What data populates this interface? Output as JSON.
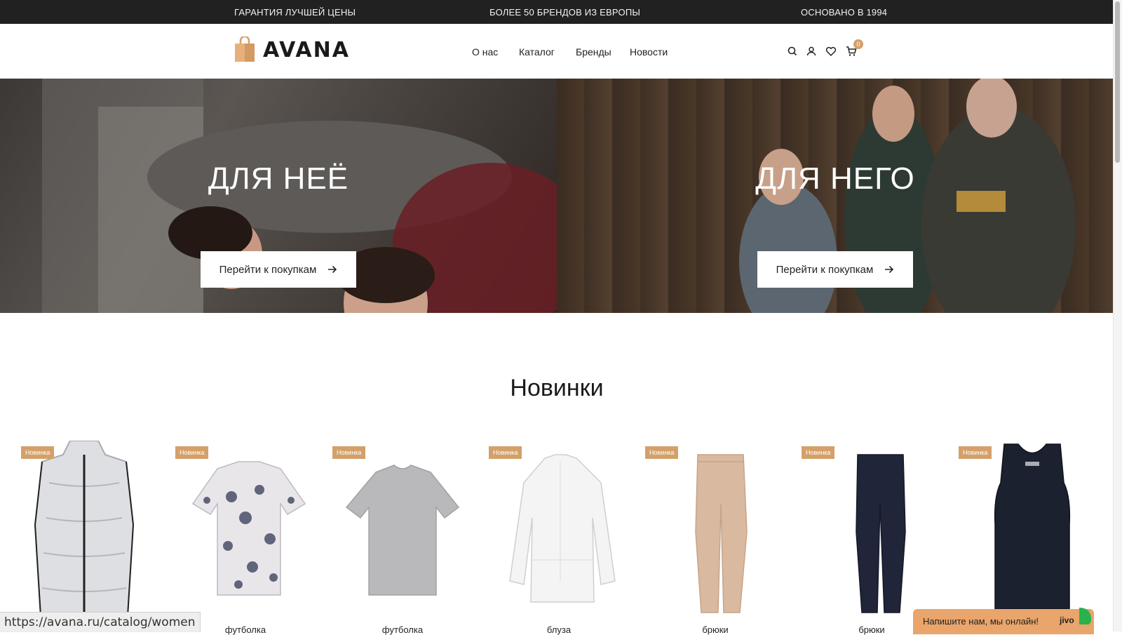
{
  "topbar": {
    "left": "ГАРАНТИЯ ЛУЧШЕЙ ЦЕНЫ",
    "center": "БОЛЕЕ 50 БРЕНДОВ ИЗ ЕВРОПЫ",
    "right": "ОСНОВАНО В 1994"
  },
  "header": {
    "logo_text": "AVANA",
    "nav": [
      "О нас",
      "Каталог",
      "Бренды",
      "Новости"
    ],
    "icons": [
      "search-icon",
      "user-icon",
      "heart-icon",
      "cart-icon"
    ],
    "cart_count": "0"
  },
  "hero": {
    "left": {
      "title": "ДЛЯ НЕЁ",
      "button": "Перейти к покупкам"
    },
    "right": {
      "title": "ДЛЯ НЕГО",
      "button": "Перейти к покупкам"
    }
  },
  "new_section": {
    "title": "Новинки",
    "badge": "Новинка",
    "products": [
      {
        "type": "vest"
      },
      {
        "type": "floral-tshirt",
        "name": "футболка"
      },
      {
        "type": "grey-tshirt",
        "name": "футболка"
      },
      {
        "type": "white-blouse",
        "name": "блуза"
      },
      {
        "type": "beige-trousers",
        "name": "брюки"
      },
      {
        "type": "navy-trousers",
        "name": "брюки"
      },
      {
        "type": "black-tank"
      }
    ]
  },
  "status_bar": {
    "url": "https://avana.ru/catalog/women"
  },
  "chat": {
    "text": "Напишите нам, мы онлайн!",
    "brand": "jivo"
  },
  "colors": {
    "accent": "#d4a06a",
    "topbar_bg": "#212121",
    "chat_bg": "#e9a56b"
  }
}
